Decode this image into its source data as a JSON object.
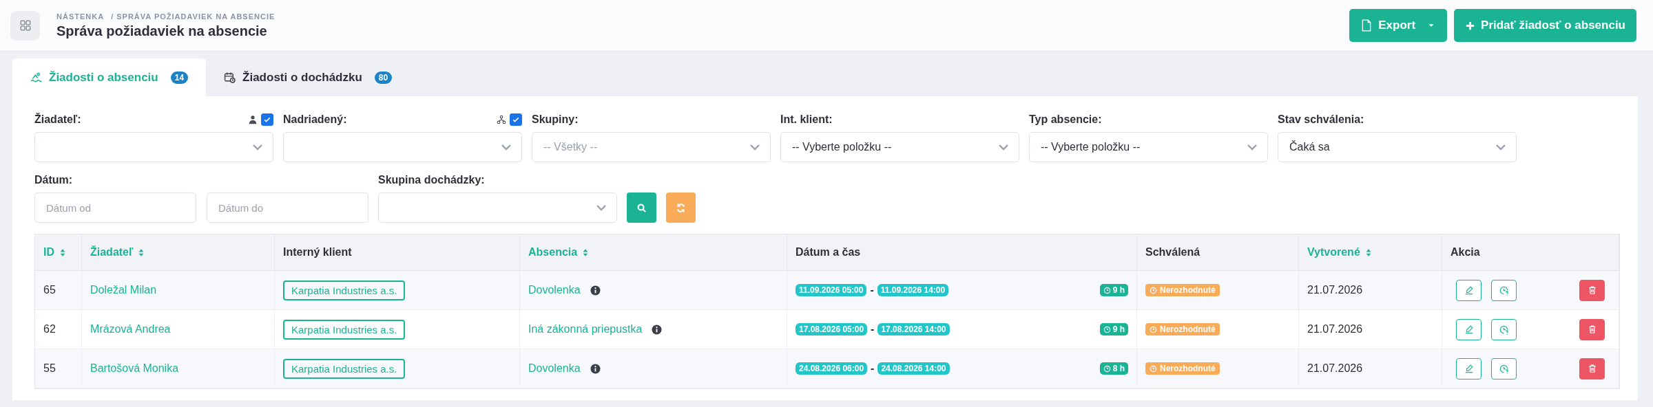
{
  "header": {
    "breadcrumb": [
      "NÁSTENKA",
      "/ SPRÁVA POŽIADAVIEK NA ABSENCIE"
    ],
    "title": "Správa požiadaviek na absencie",
    "buttons": [
      {
        "kind": "export",
        "label": "Export",
        "dropdown": true
      },
      {
        "kind": "add",
        "label": "Pridať žiadosť o absenciu",
        "dropdown": false
      }
    ]
  },
  "tabs": [
    {
      "kind": "absence",
      "label": "Žiadosti o absenciu",
      "count": "14",
      "selected": true
    },
    {
      "kind": "attendance",
      "label": "Žiadosti o dochádzku",
      "count": "80",
      "selected": false
    }
  ],
  "filters": [
    {
      "label": "Žiadateľ:",
      "toggle": {
        "kind": "person",
        "checked": true
      }
    },
    {
      "label": "Nadriadený:",
      "toggle": {
        "kind": "hierarchy",
        "checked": true
      }
    },
    {
      "label": "Skupiny:",
      "placeholder": "-- Všetky --"
    },
    {
      "label": "Int. klient:",
      "value": "-- Vyberte položku --"
    },
    {
      "label": "Typ absencie:",
      "value": "-- Vyberte položku --"
    },
    {
      "label": "Stav schválenia:",
      "value": "Čaká sa"
    }
  ],
  "date_filter": {
    "label": "Dátum:",
    "from_placeholder": "Dátum od",
    "to_placeholder": "Dátum do"
  },
  "group_filter": {
    "label": "Skupina dochádzky:"
  },
  "table": {
    "columns": [
      {
        "label": "ID",
        "sortable": true
      },
      {
        "label": "Žiadateľ",
        "sortable": true
      },
      {
        "label": "Interný klient",
        "sortable": false
      },
      {
        "label": "Absencia",
        "sortable": true
      },
      {
        "label": "Dátum a čas",
        "sortable": false
      },
      {
        "label": "Schválená",
        "sortable": false
      },
      {
        "label": "Vytvorené",
        "sortable": true
      },
      {
        "label": "Akcia",
        "sortable": false
      }
    ],
    "rows": [
      {
        "id": "65",
        "applicant": "Doležal Milan",
        "client": "Karpatia Industries a.s.",
        "absence": "Dovolenka",
        "from": "11.09.2026 05:00",
        "separator": "-",
        "to": "11.09.2026 14:00",
        "hours": "9 h",
        "status": "Nerozhodnuté",
        "created": "21.07.2026"
      },
      {
        "id": "62",
        "applicant": "Mrázová Andrea",
        "client": "Karpatia Industries a.s.",
        "absence": "Iná zákonná priepustka",
        "from": "17.08.2026 05:00",
        "separator": "-",
        "to": "17.08.2026 14:00",
        "hours": "9 h",
        "status": "Nerozhodnuté",
        "created": "21.07.2026"
      },
      {
        "id": "55",
        "applicant": "Bartošová Monika",
        "client": "Karpatia Industries a.s.",
        "absence": "Dovolenka",
        "from": "24.08.2026 06:00",
        "separator": "-",
        "to": "24.08.2026 14:00",
        "hours": "8 h",
        "status": "Nerozhodnuté",
        "created": "21.07.2026"
      }
    ]
  }
}
